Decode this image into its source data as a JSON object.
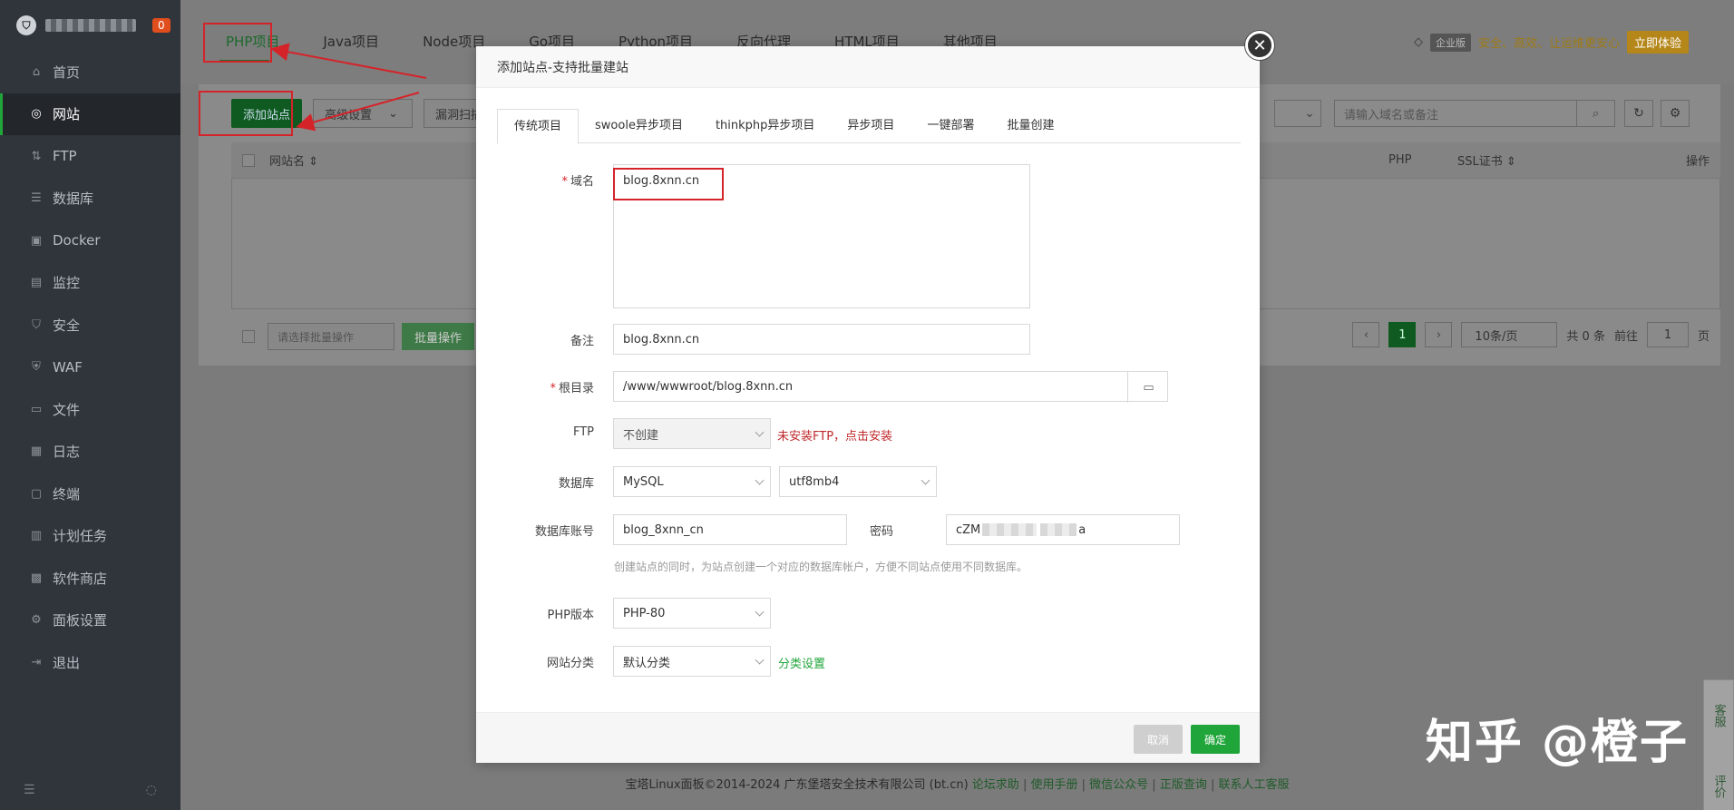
{
  "sidebar": {
    "badge": "0",
    "items": [
      {
        "label": "首页",
        "icon": "home-icon",
        "glyph": "⌂"
      },
      {
        "label": "网站",
        "icon": "globe-icon",
        "glyph": "◎"
      },
      {
        "label": "FTP",
        "icon": "ftp-icon",
        "glyph": "⇅"
      },
      {
        "label": "数据库",
        "icon": "database-icon",
        "glyph": "☰"
      },
      {
        "label": "Docker",
        "icon": "docker-icon",
        "glyph": "▣"
      },
      {
        "label": "监控",
        "icon": "monitor-icon",
        "glyph": "▤"
      },
      {
        "label": "安全",
        "icon": "shield-icon",
        "glyph": "⛉"
      },
      {
        "label": "WAF",
        "icon": "waf-icon",
        "glyph": "⛨"
      },
      {
        "label": "文件",
        "icon": "folder-icon",
        "glyph": "▭"
      },
      {
        "label": "日志",
        "icon": "log-icon",
        "glyph": "▦"
      },
      {
        "label": "终端",
        "icon": "terminal-icon",
        "glyph": "▢"
      },
      {
        "label": "计划任务",
        "icon": "schedule-icon",
        "glyph": "▥"
      },
      {
        "label": "软件商店",
        "icon": "store-icon",
        "glyph": "▩"
      },
      {
        "label": "面板设置",
        "icon": "gear-icon",
        "glyph": "⚙"
      },
      {
        "label": "退出",
        "icon": "logout-icon",
        "glyph": "⇥"
      }
    ]
  },
  "topnav": {
    "tabs": [
      "PHP项目",
      "Java项目",
      "Node项目",
      "Go项目",
      "Python项目",
      "反向代理",
      "HTML项目",
      "其他项目"
    ],
    "enterprise_badge": "企业版",
    "slogan": "安全、高效、让运维更安心",
    "trial_button": "立即体验"
  },
  "toolbar": {
    "add_site": "添加站点",
    "advanced": "高级设置",
    "vuln_scan": "漏洞扫描",
    "search_placeholder": "请输入域名或备注"
  },
  "table": {
    "headers": {
      "name": "网站名 ⇕",
      "php": "PHP",
      "ssl": "SSL证书 ⇕",
      "ops": "操作"
    },
    "batch_select": "请选择批量操作",
    "batch_button": "批量操作",
    "page_current": "1",
    "page_size": "10条/页",
    "total": "共 0 条",
    "goto_label": "前往",
    "goto_value": "1",
    "page_unit": "页"
  },
  "footer": {
    "copyright": "宝塔Linux面板©2014-2024 广东堡塔安全技术有限公司 (bt.cn)",
    "links": [
      "论坛求助",
      "使用手册",
      "微信公众号",
      "正版查询",
      "联系人工客服"
    ]
  },
  "side_float": [
    "客服",
    "评价"
  ],
  "watermark": "知乎 @橙子",
  "modal": {
    "title": "添加站点-支持批量建站",
    "tabs": [
      "传统项目",
      "swoole异步项目",
      "thinkphp异步项目",
      "异步项目",
      "一键部署",
      "批量创建"
    ],
    "domain_label": "域名",
    "domain_value": "blog.8xnn.cn",
    "remark_label": "备注",
    "remark_value": "blog.8xnn.cn",
    "root_label": "根目录",
    "root_value": "/www/wwwroot/blog.8xnn.cn",
    "ftp_label": "FTP",
    "ftp_value": "不创建",
    "ftp_warn": "未安装FTP，点击安装",
    "db_label": "数据库",
    "db_type": "MySQL",
    "db_charset": "utf8mb4",
    "db_account_label": "数据库账号",
    "db_account_value": "blog_8xnn_cn",
    "password_label": "密码",
    "password_prefix": "cZM",
    "password_suffix": "a",
    "hint": "创建站点的同时，为站点创建一个对应的数据库帐户，方便不同站点使用不同数据库。",
    "php_label": "PHP版本",
    "php_value": "PHP-80",
    "category_label": "网站分类",
    "category_value": "默认分类",
    "category_link": "分类设置",
    "cancel": "取消",
    "confirm": "确定"
  }
}
